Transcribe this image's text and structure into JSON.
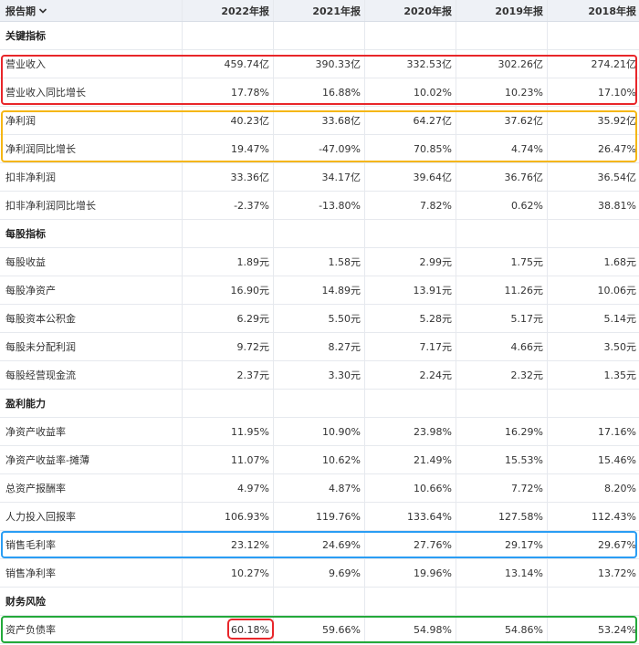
{
  "header": {
    "period_label": "报告期",
    "years": [
      "2022年报",
      "2021年报",
      "2020年报",
      "2019年报",
      "2018年报"
    ]
  },
  "rows": [
    {
      "type": "section",
      "label": "关键指标"
    },
    {
      "type": "data",
      "label": "营业收入",
      "values": [
        "459.74亿",
        "390.33亿",
        "332.53亿",
        "302.26亿",
        "274.21亿"
      ]
    },
    {
      "type": "data",
      "label": "营业收入同比增长",
      "values": [
        "17.78%",
        "16.88%",
        "10.02%",
        "10.23%",
        "17.10%"
      ]
    },
    {
      "type": "data",
      "label": "净利润",
      "values": [
        "40.23亿",
        "33.68亿",
        "64.27亿",
        "37.62亿",
        "35.92亿"
      ]
    },
    {
      "type": "data",
      "label": "净利润同比增长",
      "values": [
        "19.47%",
        "-47.09%",
        "70.85%",
        "4.74%",
        "26.47%"
      ]
    },
    {
      "type": "data",
      "label": "扣非净利润",
      "values": [
        "33.36亿",
        "34.17亿",
        "39.64亿",
        "36.76亿",
        "36.54亿"
      ]
    },
    {
      "type": "data",
      "label": "扣非净利润同比增长",
      "values": [
        "-2.37%",
        "-13.80%",
        "7.82%",
        "0.62%",
        "38.81%"
      ]
    },
    {
      "type": "section",
      "label": "每股指标"
    },
    {
      "type": "data",
      "label": "每股收益",
      "values": [
        "1.89元",
        "1.58元",
        "2.99元",
        "1.75元",
        "1.68元"
      ]
    },
    {
      "type": "data",
      "label": "每股净资产",
      "values": [
        "16.90元",
        "14.89元",
        "13.91元",
        "11.26元",
        "10.06元"
      ]
    },
    {
      "type": "data",
      "label": "每股资本公积金",
      "values": [
        "6.29元",
        "5.50元",
        "5.28元",
        "5.17元",
        "5.14元"
      ]
    },
    {
      "type": "data",
      "label": "每股未分配利润",
      "values": [
        "9.72元",
        "8.27元",
        "7.17元",
        "4.66元",
        "3.50元"
      ]
    },
    {
      "type": "data",
      "label": "每股经营现金流",
      "values": [
        "2.37元",
        "3.30元",
        "2.24元",
        "2.32元",
        "1.35元"
      ]
    },
    {
      "type": "section",
      "label": "盈利能力"
    },
    {
      "type": "data",
      "label": "净资产收益率",
      "values": [
        "11.95%",
        "10.90%",
        "23.98%",
        "16.29%",
        "17.16%"
      ]
    },
    {
      "type": "data",
      "label": "净资产收益率-摊薄",
      "values": [
        "11.07%",
        "10.62%",
        "21.49%",
        "15.53%",
        "15.46%"
      ]
    },
    {
      "type": "data",
      "label": "总资产报酬率",
      "values": [
        "4.97%",
        "4.87%",
        "10.66%",
        "7.72%",
        "8.20%"
      ]
    },
    {
      "type": "data",
      "label": "人力投入回报率",
      "values": [
        "106.93%",
        "119.76%",
        "133.64%",
        "127.58%",
        "112.43%"
      ]
    },
    {
      "type": "data",
      "label": "销售毛利率",
      "values": [
        "23.12%",
        "24.69%",
        "27.76%",
        "29.17%",
        "29.67%"
      ]
    },
    {
      "type": "data",
      "label": "销售净利率",
      "values": [
        "10.27%",
        "9.69%",
        "19.96%",
        "13.14%",
        "13.72%"
      ]
    },
    {
      "type": "section",
      "label": "财务风险"
    },
    {
      "type": "data",
      "label": "资产负债率",
      "values": [
        "60.18%",
        "59.66%",
        "54.98%",
        "54.86%",
        "53.24%"
      ]
    }
  ],
  "highlight_colors": {
    "red": "#e8262a",
    "orange": "#f5b614",
    "blue": "#2a9df4",
    "green": "#23a93a"
  }
}
